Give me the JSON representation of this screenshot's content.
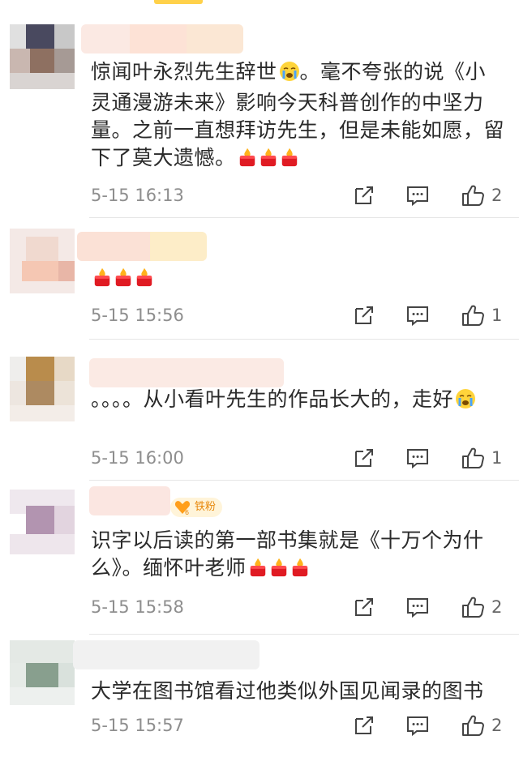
{
  "comments": [
    {
      "text": "惊闻叶永烈先生辞世",
      "text_after_emoji": "。毫不夸张的说《小灵通漫游未来》影响今天科普创作的中坚力量。之前一直想拜访先生，但是未能如愿，留下了莫大遗憾。",
      "emoji_inline": "crying-face-icon",
      "emoji_tail": [
        "candle-icon",
        "candle-icon",
        "candle-icon"
      ],
      "time": "5-15 16:13",
      "likes": "2"
    },
    {
      "text": "",
      "emoji_tail": [
        "candle-icon",
        "candle-icon",
        "candle-icon"
      ],
      "time": "5-15 15:56",
      "likes": "1"
    },
    {
      "text": "。。。。从小看叶先生的作品长大的，走好",
      "emoji_tail": [
        "crying-face-icon"
      ],
      "time": "5-15 16:00",
      "likes": "1"
    },
    {
      "badge": "铁粉",
      "text": "识字以后读的第一部书集就是《十万个为什么》。缅怀叶老师",
      "emoji_tail": [
        "candle-icon",
        "candle-icon",
        "candle-icon"
      ],
      "time": "5-15 15:58",
      "likes": "2"
    },
    {
      "text": "大学在图书馆看过他类似外国见闻录的图书",
      "time": "5-15 15:57",
      "likes": "2"
    }
  ],
  "colors": {
    "text": "#2a2a2a",
    "meta": "#8e8e8e",
    "divider": "#e6e6e6",
    "accent": "#ffd14a",
    "badge": "#e8890c"
  }
}
